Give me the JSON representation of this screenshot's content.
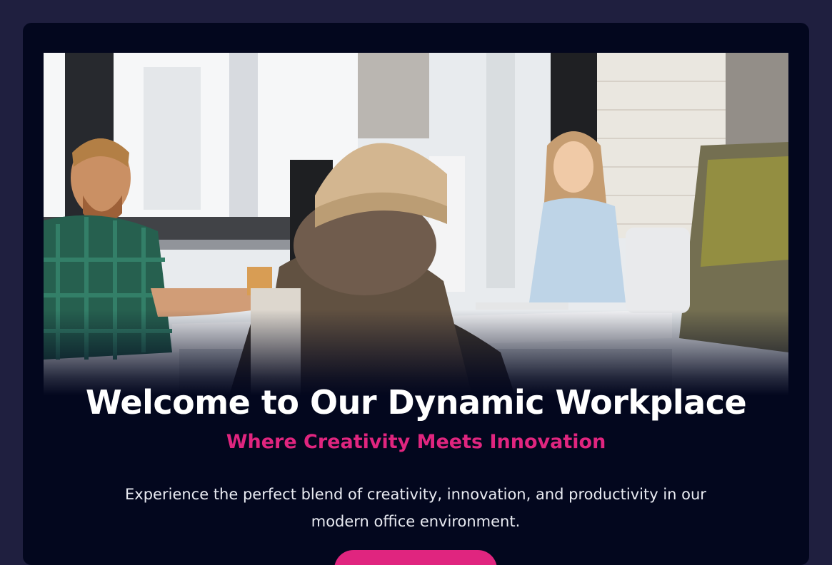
{
  "hero": {
    "title": "Welcome to Our Dynamic Workplace",
    "subtitle": "Where Creativity Meets Innovation",
    "description": "Experience the perfect blend of creativity, innovation, and productivity in our modern office environment.",
    "cta_label": ""
  },
  "colors": {
    "page_background": "#1f1f3f",
    "card_background": "#03071e",
    "accent": "#e0257f",
    "title_text": "#ffffff",
    "body_text": "#e9ebf2"
  },
  "image": {
    "subject": "office-team-photo"
  }
}
